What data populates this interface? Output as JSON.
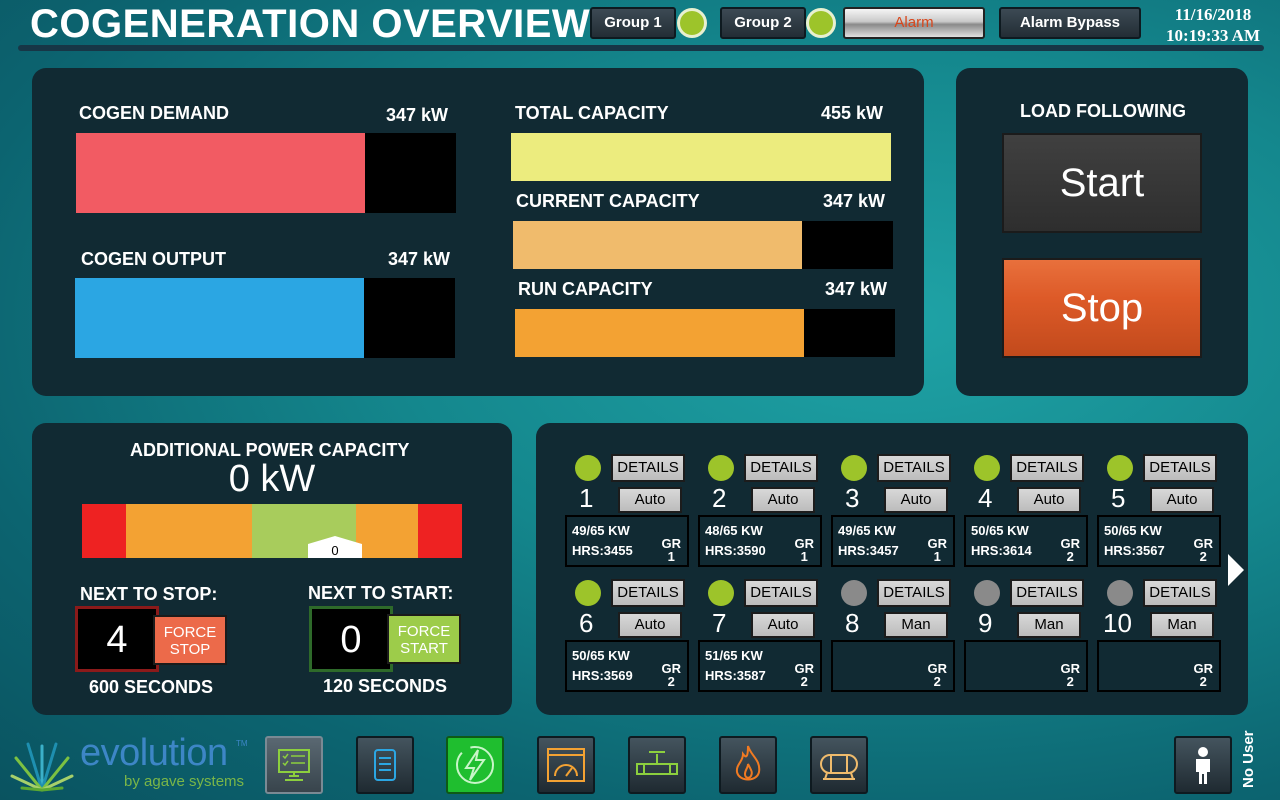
{
  "header": {
    "title": "COGENERATION OVERVIEW",
    "group1_label": "Group 1",
    "group2_label": "Group 2",
    "alarm_label": "Alarm",
    "alarm_bypass_label": "Alarm Bypass",
    "date": "11/16/2018",
    "time": "10:19:33 AM"
  },
  "power": {
    "cogen_demand_label": "COGEN DEMAND",
    "cogen_demand_value": "347 kW",
    "cogen_demand_fraction": 0.76,
    "cogen_output_label": "COGEN OUTPUT",
    "cogen_output_value": "347 kW",
    "cogen_output_fraction": 0.76,
    "total_capacity_label": "TOTAL CAPACITY",
    "total_capacity_value": "455 kW",
    "total_capacity_fraction": 1.0,
    "current_capacity_label": "CURRENT CAPACITY",
    "current_capacity_value": "347 kW",
    "current_capacity_fraction": 0.76,
    "run_capacity_label": "RUN CAPACITY",
    "run_capacity_value": "347 kW",
    "run_capacity_fraction": 0.76
  },
  "load_following": {
    "title": "LOAD FOLLOWING",
    "start_label": "Start",
    "stop_label": "Stop"
  },
  "additional": {
    "title": "ADDITIONAL POWER CAPACITY",
    "value": "0 kW",
    "gauge_marker": "0",
    "next_to_stop_label": "NEXT TO STOP:",
    "next_to_stop_value": "4",
    "force_stop_label": "FORCE STOP",
    "stop_seconds": "600 SECONDS",
    "next_to_start_label": "NEXT TO START:",
    "next_to_start_value": "0",
    "force_start_label": "FORCE START",
    "start_seconds": "120 SECONDS"
  },
  "units": [
    {
      "num": "1",
      "mode": "Auto",
      "details": "DETAILS",
      "kw": "49/65 KW",
      "hrs": "HRS:3455",
      "gr": "GR",
      "group": "1",
      "active": true
    },
    {
      "num": "2",
      "mode": "Auto",
      "details": "DETAILS",
      "kw": "48/65 KW",
      "hrs": "HRS:3590",
      "gr": "GR",
      "group": "1",
      "active": true
    },
    {
      "num": "3",
      "mode": "Auto",
      "details": "DETAILS",
      "kw": "49/65 KW",
      "hrs": "HRS:3457",
      "gr": "GR",
      "group": "1",
      "active": true
    },
    {
      "num": "4",
      "mode": "Auto",
      "details": "DETAILS",
      "kw": "50/65 KW",
      "hrs": "HRS:3614",
      "gr": "GR",
      "group": "2",
      "active": true
    },
    {
      "num": "5",
      "mode": "Auto",
      "details": "DETAILS",
      "kw": "50/65 KW",
      "hrs": "HRS:3567",
      "gr": "GR",
      "group": "2",
      "active": true
    },
    {
      "num": "6",
      "mode": "Auto",
      "details": "DETAILS",
      "kw": "50/65 KW",
      "hrs": "HRS:3569",
      "gr": "GR",
      "group": "2",
      "active": true
    },
    {
      "num": "7",
      "mode": "Auto",
      "details": "DETAILS",
      "kw": "51/65 KW",
      "hrs": "HRS:3587",
      "gr": "GR",
      "group": "2",
      "active": true
    },
    {
      "num": "8",
      "mode": "Man",
      "details": "DETAILS",
      "kw": "",
      "hrs": "",
      "gr": "GR",
      "group": "2",
      "active": false
    },
    {
      "num": "9",
      "mode": "Man",
      "details": "DETAILS",
      "kw": "",
      "hrs": "",
      "gr": "GR",
      "group": "2",
      "active": false
    },
    {
      "num": "10",
      "mode": "Man",
      "details": "DETAILS",
      "kw": "",
      "hrs": "",
      "gr": "GR",
      "group": "2",
      "active": false
    }
  ],
  "footer": {
    "brand": "evolution",
    "trademark": "TM",
    "brand_sub": "by agave systems",
    "user_label": "No User",
    "nav_icons": [
      "monitor-checklist-icon",
      "document-icon",
      "lightning-icon",
      "gauge-window-icon",
      "pipe-valve-icon",
      "flame-icon",
      "tank-icon"
    ]
  },
  "colors": {
    "demand": "#f25b63",
    "output": "#2ba6e3",
    "total": "#ecec7e",
    "current": "#f0bb6c",
    "run": "#f3a233",
    "stop_btn": "#dd5a28",
    "start_btn": "#404040",
    "led_on": "#9dc42a",
    "led_off": "#8a8a8a"
  }
}
